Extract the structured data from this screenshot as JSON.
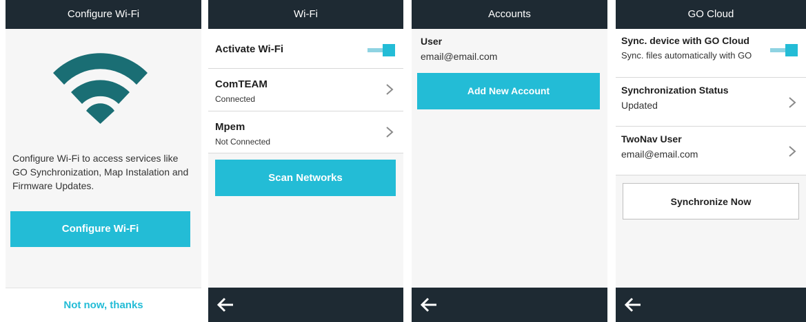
{
  "configure_screen": {
    "title": "Configure Wi-Fi",
    "icon": "wifi-icon",
    "description": "Configure Wi-Fi to access services like GO Synchronization, Map Instalation and Firmware Updates.",
    "primary_button": "Configure Wi-Fi",
    "secondary_link": "Not now, thanks"
  },
  "wifi_screen": {
    "title": "Wi-Fi",
    "activate": {
      "label": "Activate Wi-Fi",
      "enabled": true
    },
    "networks": [
      {
        "name": "ComTEAM",
        "status": "Connected"
      },
      {
        "name": "Mpem",
        "status": "Not Connected"
      }
    ],
    "scan_button": "Scan Networks"
  },
  "accounts_screen": {
    "title": "Accounts",
    "account": {
      "label": "User",
      "email": "email@email.com"
    },
    "add_button": "Add New Account"
  },
  "gocloud_screen": {
    "title": "GO Cloud",
    "sync_device": {
      "label": "Sync. device with GO Cloud",
      "sublabel": "Sync. files automatically with GO",
      "enabled": true
    },
    "sync_status": {
      "label": "Synchronization Status",
      "value": "Updated"
    },
    "twonav_user": {
      "label": "TwoNav User",
      "value": "email@email.com"
    },
    "sync_button": "Synchronize Now"
  },
  "colors": {
    "accent": "#23bcd6",
    "bar": "#1e2a33",
    "background": "#f6f6f6"
  }
}
